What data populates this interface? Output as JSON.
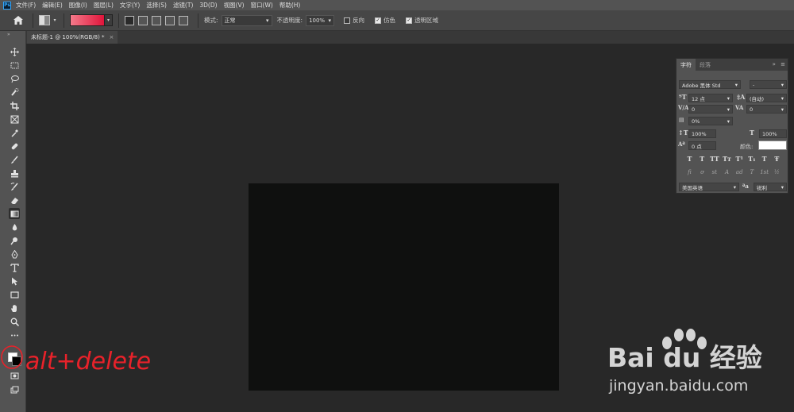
{
  "menubar": {
    "logo": "Ps",
    "items": [
      "文件(F)",
      "编辑(E)",
      "图像(I)",
      "图层(L)",
      "文字(Y)",
      "选择(S)",
      "滤镜(T)",
      "3D(D)",
      "视图(V)",
      "窗口(W)",
      "帮助(H)"
    ]
  },
  "options": {
    "mode_label": "模式:",
    "mode_value": "正常",
    "opacity_label": "不透明度:",
    "opacity_value": "100%",
    "reverse_label": "反向",
    "dither_label": "仿色",
    "transparency_label": "透明区域",
    "reverse_checked": false,
    "dither_checked": true,
    "transparency_checked": true,
    "gradient_colors": [
      "#f47a8a",
      "#e0153b"
    ]
  },
  "document": {
    "tab_title": "未标题-1 @ 100%(RGB/8) *",
    "close_glyph": "×",
    "canvas_color": "#0f100f"
  },
  "toolbar": {
    "collapse_glyph": "»",
    "tools": [
      "move-tool",
      "marquee-tool",
      "lasso-tool",
      "quick-select-tool",
      "crop-tool",
      "frame-tool",
      "eyedropper-tool",
      "healing-brush-tool",
      "brush-tool",
      "clone-stamp-tool",
      "history-brush-tool",
      "eraser-tool",
      "gradient-tool",
      "blur-tool",
      "dodge-tool",
      "pen-tool",
      "type-tool",
      "path-select-tool",
      "rectangle-tool",
      "hand-tool",
      "zoom-tool",
      "more-tools"
    ],
    "foreground_color": "#ffffff",
    "background_color": "#000000"
  },
  "character_panel": {
    "tab_character": "字符",
    "tab_paragraph": "段落",
    "menu_glyph": "≡",
    "collapse_glyph": "»",
    "font_family": "Adobe 黑体 Std",
    "font_style": "-",
    "font_size": "12 点",
    "leading": "(自动)",
    "kerning": "0",
    "tracking": "0",
    "tsume": "0%",
    "vertical_scale": "100%",
    "horizontal_scale": "100%",
    "baseline_shift": "0 点",
    "color_label": "颜色:",
    "color_value": "#ffffff",
    "language": "美国英语",
    "antialias_label": "ªa",
    "antialias": "锐利",
    "typo_buttons": [
      "T",
      "T",
      "TT",
      "Tт",
      "T¹",
      "T₁",
      "T",
      "Ŧ"
    ],
    "opentype_buttons": [
      "fi",
      "ơ",
      "st",
      "A",
      "ad",
      "T",
      "1st",
      "½"
    ]
  },
  "annotation": {
    "text": "alt+delete",
    "color": "#e8222a"
  },
  "watermark": {
    "brand": "Bai du 经验",
    "url": "jingyan.baidu.com"
  }
}
